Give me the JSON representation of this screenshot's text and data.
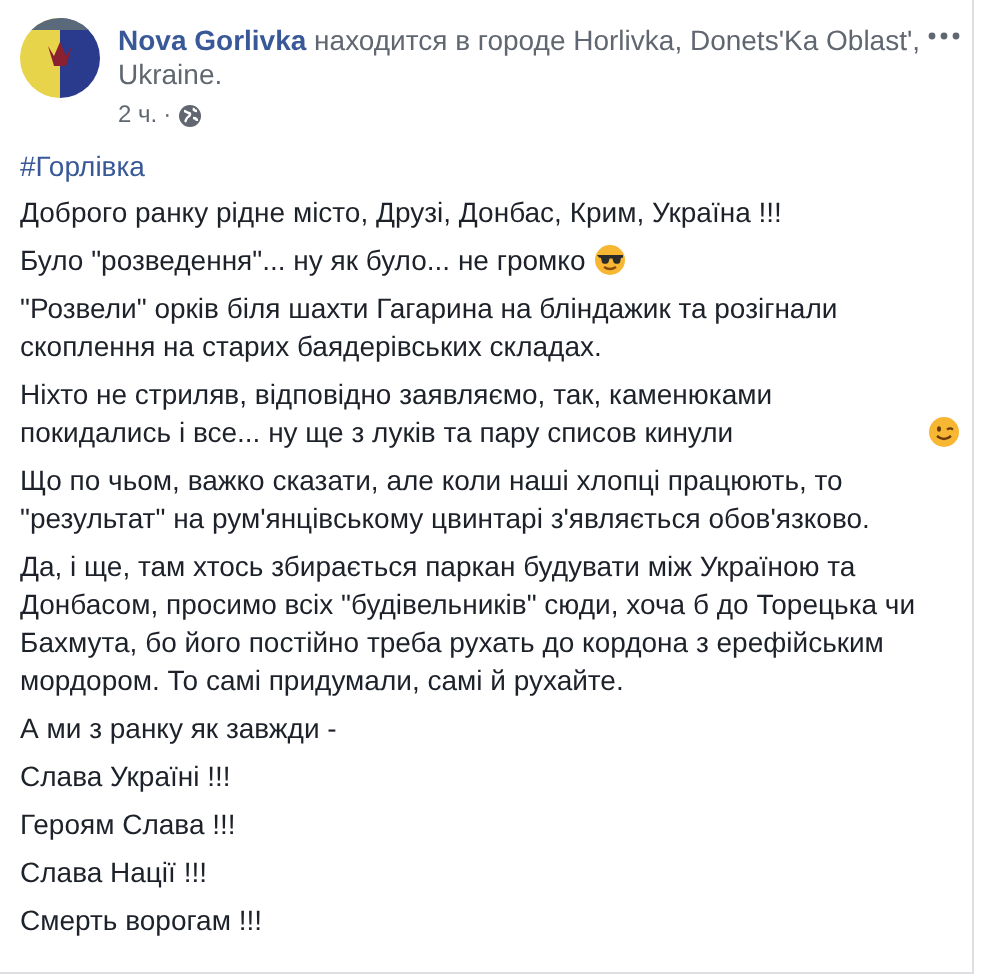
{
  "post": {
    "author": "Nova Gorlivka",
    "location_text": "находится в городе Horlivka, Donets'Ka Oblast', Ukraine.",
    "time": "2 ч.",
    "separator": "·",
    "hashtag": "#Горлівка",
    "paragraphs": [
      {
        "text": "Доброго ранку рідне місто, Друзі, Донбас, Крим, Україна !!!"
      },
      {
        "text": "Було \"розведення\"... ну як було... не громко",
        "kind": "sunglasses"
      },
      {
        "text": "\"Розвели\" орків біля шахти Гагарина на бліндажик та розігнали скоплення на старих баядерівських складах."
      },
      {
        "text": "Ніхто не стриляв, відповідно заявляємо, так, каменюками покидались і все... ну ще з луків та пару списов кинули",
        "kind": "wink"
      },
      {
        "text": "Що по чьом, важко сказати, але коли наші хлопці працюють, то \"результат\" на рум'янцівському цвинтарі з'являється обов'язково."
      },
      {
        "text": "Да, і ще, там хтось збирається паркан будувати між Україною та Донбасом, просимо всіх \"будівельників\" сюди, хоча б до Торецька чи Бахмута, бо його постійно треба рухать до кордона з ерефійським мордором. То самі придумали, самі й рухайте."
      },
      {
        "text": "А ми з ранку як завжди -"
      },
      {
        "text": "Слава Україні !!!"
      },
      {
        "text": "Героям Слава !!!"
      },
      {
        "text": "Слава Нації !!!"
      },
      {
        "text": "Смерть ворогам !!!"
      }
    ]
  }
}
